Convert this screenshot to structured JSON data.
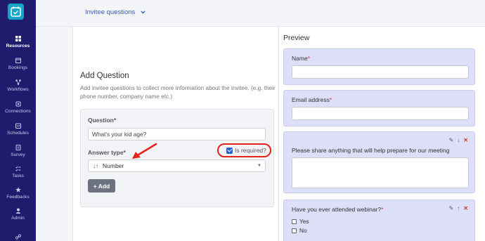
{
  "sidebar": {
    "items": [
      {
        "label": "Resources",
        "icon": "grid-icon",
        "active": true
      },
      {
        "label": "Bookings",
        "icon": "calendar-icon",
        "active": false
      },
      {
        "label": "Workflows",
        "icon": "workflow-icon",
        "active": false
      },
      {
        "label": "Connections",
        "icon": "plug-icon",
        "active": false
      },
      {
        "label": "Schedules",
        "icon": "schedule-icon",
        "active": false
      },
      {
        "label": "Survey",
        "icon": "survey-icon",
        "active": false
      },
      {
        "label": "Tasks",
        "icon": "tasks-icon",
        "active": false
      },
      {
        "label": "Feedbacks",
        "icon": "star-icon",
        "active": false
      },
      {
        "label": "Admin",
        "icon": "admin-icon",
        "active": false
      }
    ]
  },
  "topbar": {
    "section_dropdown": "Invitee questions"
  },
  "add_question": {
    "title": "Add Question",
    "description": "Add invitee questions to collect more information about the invitee. (e.g. their phone number, company name etc.)",
    "question_label": "Question*",
    "question_value": "What's your kid age?",
    "answer_type_label": "Answer type",
    "answer_type_star": "*",
    "answer_type_value": "Number",
    "is_required_label": "Is required?",
    "is_required_checked": true,
    "add_button": "Add"
  },
  "preview": {
    "title": "Preview",
    "fields": [
      {
        "label": "Name",
        "required_mark": "*"
      },
      {
        "label": "Email address",
        "required_mark": "*"
      },
      {
        "label": "Please share anything that will help prepare for our meeting"
      },
      {
        "label": "Have you ever attended webinar?",
        "required_mark": "*",
        "options": [
          "Yes",
          "No"
        ]
      }
    ]
  },
  "colors": {
    "sidebar_bg": "#1f1c6e",
    "accent": "#2563c9",
    "annotation_red": "#e0251b",
    "preview_card_bg": "#dcdff7"
  }
}
